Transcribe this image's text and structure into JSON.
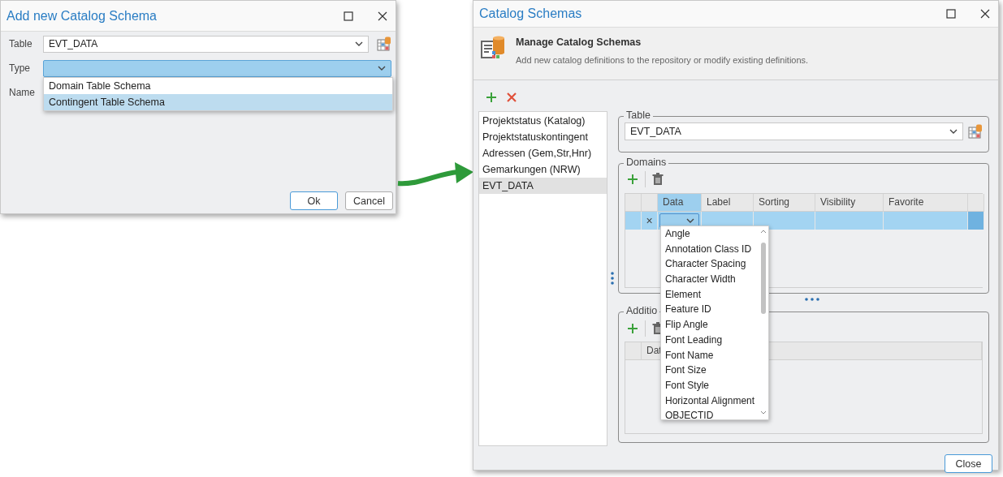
{
  "add_dialog": {
    "title": "Add new Catalog Schema",
    "fields": [
      {
        "label": "Table",
        "kind": "combo",
        "value": "EVT_DATA",
        "open": false
      },
      {
        "label": "Type",
        "kind": "combo",
        "open": true
      },
      {
        "label": "Name",
        "kind": "text"
      }
    ],
    "type_options": [
      {
        "label": "Domain Table Schema",
        "selected": false
      },
      {
        "label": "Contingent Table Schema",
        "selected": true
      }
    ],
    "buttons": [
      {
        "label": "Ok",
        "default": true
      },
      {
        "label": "Cancel",
        "default": false
      }
    ]
  },
  "catalog_window": {
    "title": "Catalog Schemas",
    "header": {
      "heading": "Manage Catalog Schemas",
      "description": "Add new catalog definitions to the repository or modify existing definitions."
    },
    "schemas": [
      {
        "label": "Projektstatus (Katalog)",
        "selected": false
      },
      {
        "label": "Projektstatuskontingent",
        "selected": false
      },
      {
        "label": "Adressen (Gem,Str,Hnr)",
        "selected": false
      },
      {
        "label": "Gemarkungen (NRW)",
        "selected": false
      },
      {
        "label": "EVT_DATA",
        "selected": true
      }
    ],
    "table_group": {
      "legend": "Table",
      "value": "EVT_DATA"
    },
    "domains_group": {
      "legend": "Domains",
      "columns": [
        {
          "label": "Data",
          "selected": true
        },
        {
          "label": "Label",
          "selected": false
        },
        {
          "label": "Sorting",
          "selected": false
        },
        {
          "label": "Visibility",
          "selected": false
        },
        {
          "label": "Favorite",
          "selected": false
        }
      ],
      "row": {
        "selected": true,
        "delete_mark": "×"
      }
    },
    "data_options": [
      {
        "label": "Angle",
        "selected": false
      },
      {
        "label": "Annotation Class ID",
        "selected": false
      },
      {
        "label": "Character Spacing",
        "selected": false
      },
      {
        "label": "Character Width",
        "selected": false
      },
      {
        "label": "Element",
        "selected": false
      },
      {
        "label": "Feature ID",
        "selected": false
      },
      {
        "label": "Flip Angle",
        "selected": false
      },
      {
        "label": "Font Leading",
        "selected": false
      },
      {
        "label": "Font Name",
        "selected": false
      },
      {
        "label": "Font Size",
        "selected": false
      },
      {
        "label": "Font Style",
        "selected": false
      },
      {
        "label": "Horizontal Alignment",
        "selected": false
      },
      {
        "label": "OBJECTID",
        "selected": false
      }
    ],
    "additional_group": {
      "legend": "Additio",
      "columns": [
        "Dat"
      ]
    },
    "buttons": [
      {
        "label": "Close",
        "default": true
      }
    ]
  }
}
